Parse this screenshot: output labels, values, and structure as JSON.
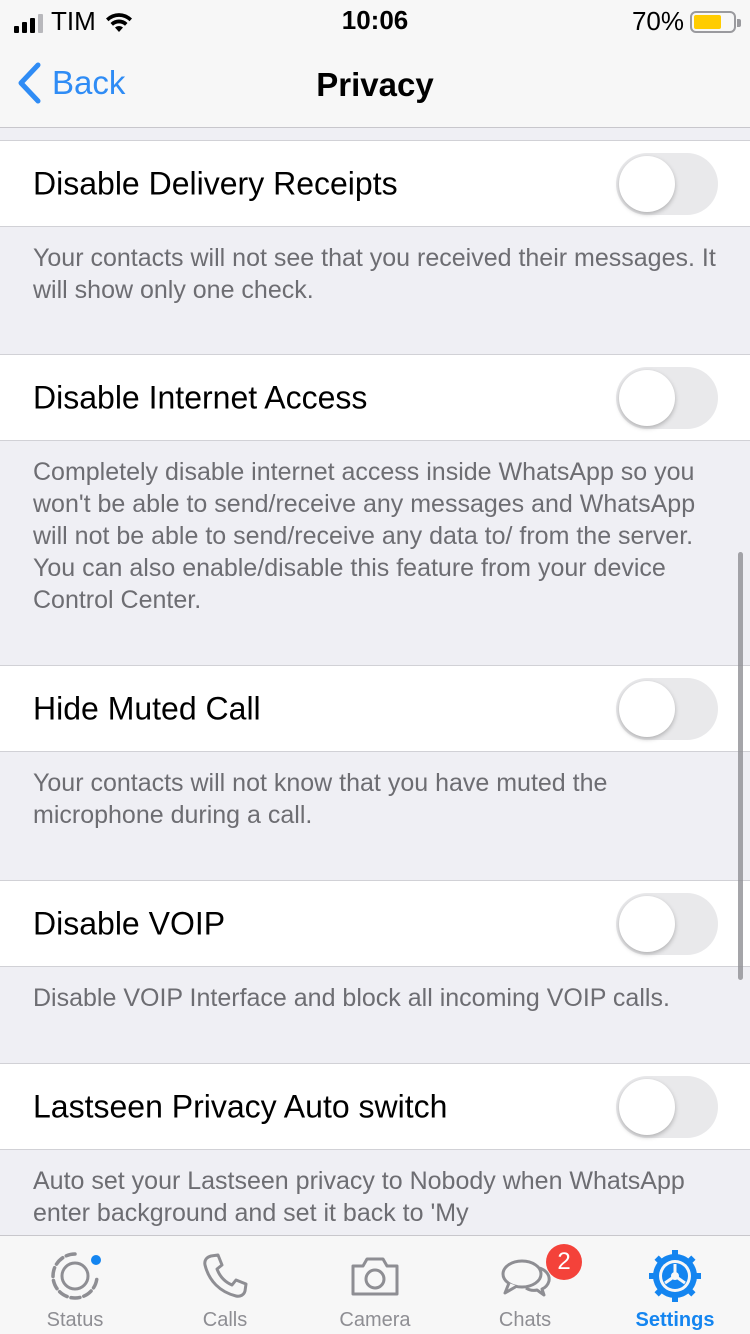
{
  "status_bar": {
    "carrier": "TIM",
    "time": "10:06",
    "battery_percent": "70%",
    "battery_level": 0.7,
    "battery_color": "#ffcc00"
  },
  "nav": {
    "back_label": "Back",
    "title": "Privacy"
  },
  "settings": [
    {
      "label": "Disable Delivery Receipts",
      "enabled": false,
      "description": "Your contacts will not see that you received their messages. It will show only one check."
    },
    {
      "label": "Disable Internet Access",
      "enabled": false,
      "description": "Completely disable internet access inside WhatsApp so you won't be able to send/receive any messages and WhatsApp will not be able to send/receive any data to/ from the server. You can also enable/disable this feature from your device Control Center."
    },
    {
      "label": "Hide Muted Call",
      "enabled": false,
      "description": "Your contacts will not know that you have muted the microphone during a call."
    },
    {
      "label": "Disable VOIP",
      "enabled": false,
      "description": "Disable VOIP Interface and block all incoming VOIP calls."
    },
    {
      "label": "Lastseen Privacy Auto switch",
      "enabled": false,
      "description": "Auto set your Lastseen privacy to Nobody when WhatsApp enter background and set it back to 'My"
    }
  ],
  "tabs": [
    {
      "label": "Status",
      "icon": "status-icon"
    },
    {
      "label": "Calls",
      "icon": "phone-icon"
    },
    {
      "label": "Camera",
      "icon": "camera-icon"
    },
    {
      "label": "Chats",
      "icon": "chat-bubbles-icon",
      "badge": "2"
    },
    {
      "label": "Settings",
      "icon": "gear-icon",
      "active": true
    }
  ],
  "colors": {
    "accent": "#1485f0",
    "badge": "#f4423a"
  }
}
